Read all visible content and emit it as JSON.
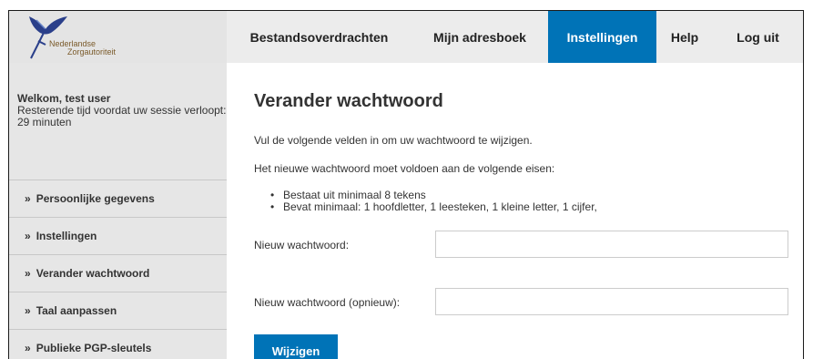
{
  "logo": {
    "line1": "Nederlandse",
    "line2": "Zorgautoriteit",
    "icon": "bird-sword-logo-icon"
  },
  "nav": {
    "items": [
      {
        "label": "Bestandsoverdrachten",
        "active": false
      },
      {
        "label": "Mijn adresboek",
        "active": false
      },
      {
        "label": "Instellingen",
        "active": true
      },
      {
        "label": "Help",
        "active": false
      },
      {
        "label": "Log uit",
        "active": false
      }
    ]
  },
  "sidebar": {
    "welcome": "Welkom, test user",
    "session_text": "Resterende tijd voordat uw sessie verloopt: 29 minuten",
    "arrow": "»",
    "items": [
      {
        "label": "Persoonlijke gegevens"
      },
      {
        "label": "Instellingen"
      },
      {
        "label": "Verander wachtwoord"
      },
      {
        "label": "Taal aanpassen"
      },
      {
        "label": "Publieke PGP-sleutels"
      }
    ]
  },
  "main": {
    "title": "Verander wachtwoord",
    "intro1": "Vul de volgende velden in om uw wachtwoord te wijzigen.",
    "intro2": "Het nieuwe wachtwoord moet voldoen aan de volgende eisen:",
    "requirements": [
      "Bestaat uit minimaal 8 tekens",
      "Bevat minimaal: 1 hoofdletter, 1 leesteken, 1 kleine letter, 1 cijfer,"
    ],
    "new_password_label": "Nieuw wachtwoord:",
    "new_password_value": "",
    "new_password_repeat_label": "Nieuw wachtwoord (opnieuw):",
    "new_password_repeat_value": "",
    "submit_label": "Wijzigen"
  },
  "colors": {
    "accent": "#0073b7",
    "header_bg": "#ececec",
    "sidebar_bg": "#e6e6e6"
  }
}
